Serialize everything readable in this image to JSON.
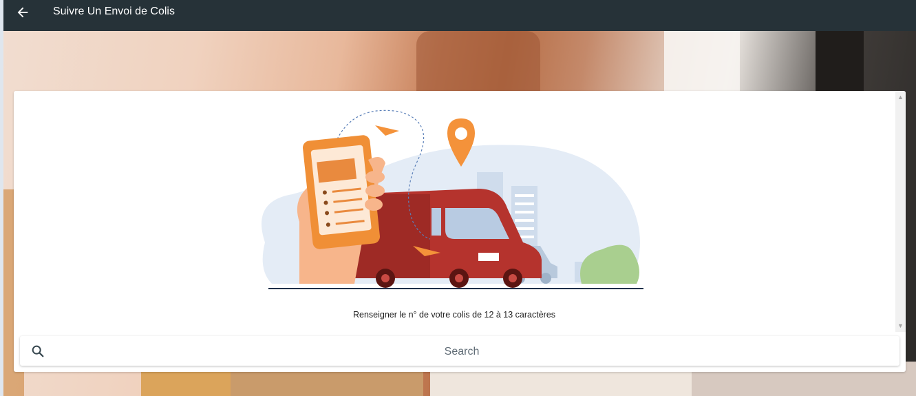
{
  "header": {
    "title": "Suivre Un Envoi de Colis",
    "back_icon": "arrow-left-icon"
  },
  "main": {
    "hint_text": "Renseigner le n° de votre colis de 12 à 13 caractères",
    "illustration": "delivery-truck-phone-tracking-illustration"
  },
  "search": {
    "placeholder": "Search",
    "value": "",
    "icon": "search-icon"
  },
  "colors": {
    "topbar": "#263238",
    "accent_orange": "#f4923a",
    "truck_red": "#b5332d"
  }
}
